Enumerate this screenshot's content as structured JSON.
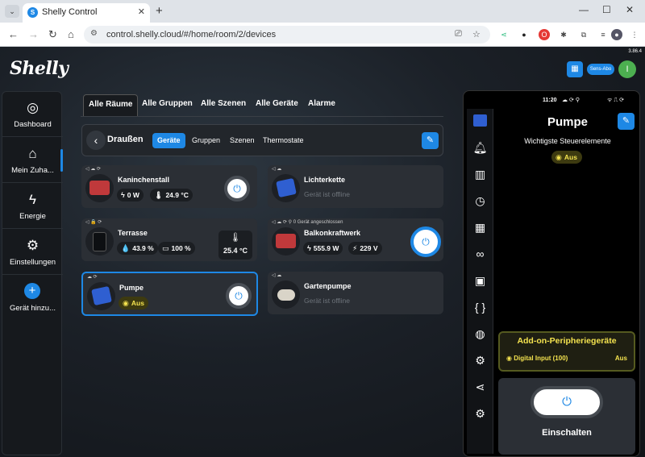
{
  "browser": {
    "tab_title": "Shelly Control",
    "tab_favicon": "S",
    "tab_close": "✕",
    "new_tab": "+",
    "url": "control.shelly.cloud/#/home/room/2/devices"
  },
  "app": {
    "logo": "Shelly",
    "version": "3.86.4",
    "header_pill": "Sens-Abo",
    "user_initial": "I"
  },
  "leftnav": {
    "items": [
      {
        "label": "Dashboard",
        "icon": "◎"
      },
      {
        "label": "Mein Zuha...",
        "icon": "⌂"
      },
      {
        "label": "Energie",
        "icon": "ϟ"
      },
      {
        "label": "Einstellungen",
        "icon": "⚙"
      },
      {
        "label": "Gerät hinzu...",
        "icon": "+"
      }
    ]
  },
  "maintabs": [
    "Alle Räume",
    "Alle Gruppen",
    "Alle Szenen",
    "Alle Geräte",
    "Alarme"
  ],
  "room": {
    "title": "Draußen",
    "subtabs": [
      "Geräte",
      "Gruppen",
      "Szenen",
      "Thermostate"
    ]
  },
  "devices": {
    "kaninchenstall": {
      "name": "Kaninchenstall",
      "power": "0 W",
      "temp": "24.9 °C"
    },
    "lichterkette": {
      "name": "Lichterkette",
      "status": "Gerät ist offline"
    },
    "terrasse": {
      "name": "Terrasse",
      "humidity": "43.9 %",
      "battery": "100 %",
      "temp": "25.4 °C"
    },
    "balkon": {
      "name": "Balkonkraftwerk",
      "topic": "0 Gerät angeschlossen",
      "power": "555.9 W",
      "voltage": "229 V"
    },
    "pumpe": {
      "name": "Pumpe",
      "state": "Aus"
    },
    "gartenpumpe": {
      "name": "Gartenpumpe",
      "status": "Gerät ist offline"
    }
  },
  "panel": {
    "time": "11:20",
    "title": "Pumpe",
    "subtitle": "Wichtigste Steuerelemente",
    "state": "Aus",
    "addon_title": "Add-on-Peripheriegeräte",
    "addon_label": "Digital Input (100)",
    "addon_value": "Aus",
    "switch_label": "Einschalten"
  }
}
